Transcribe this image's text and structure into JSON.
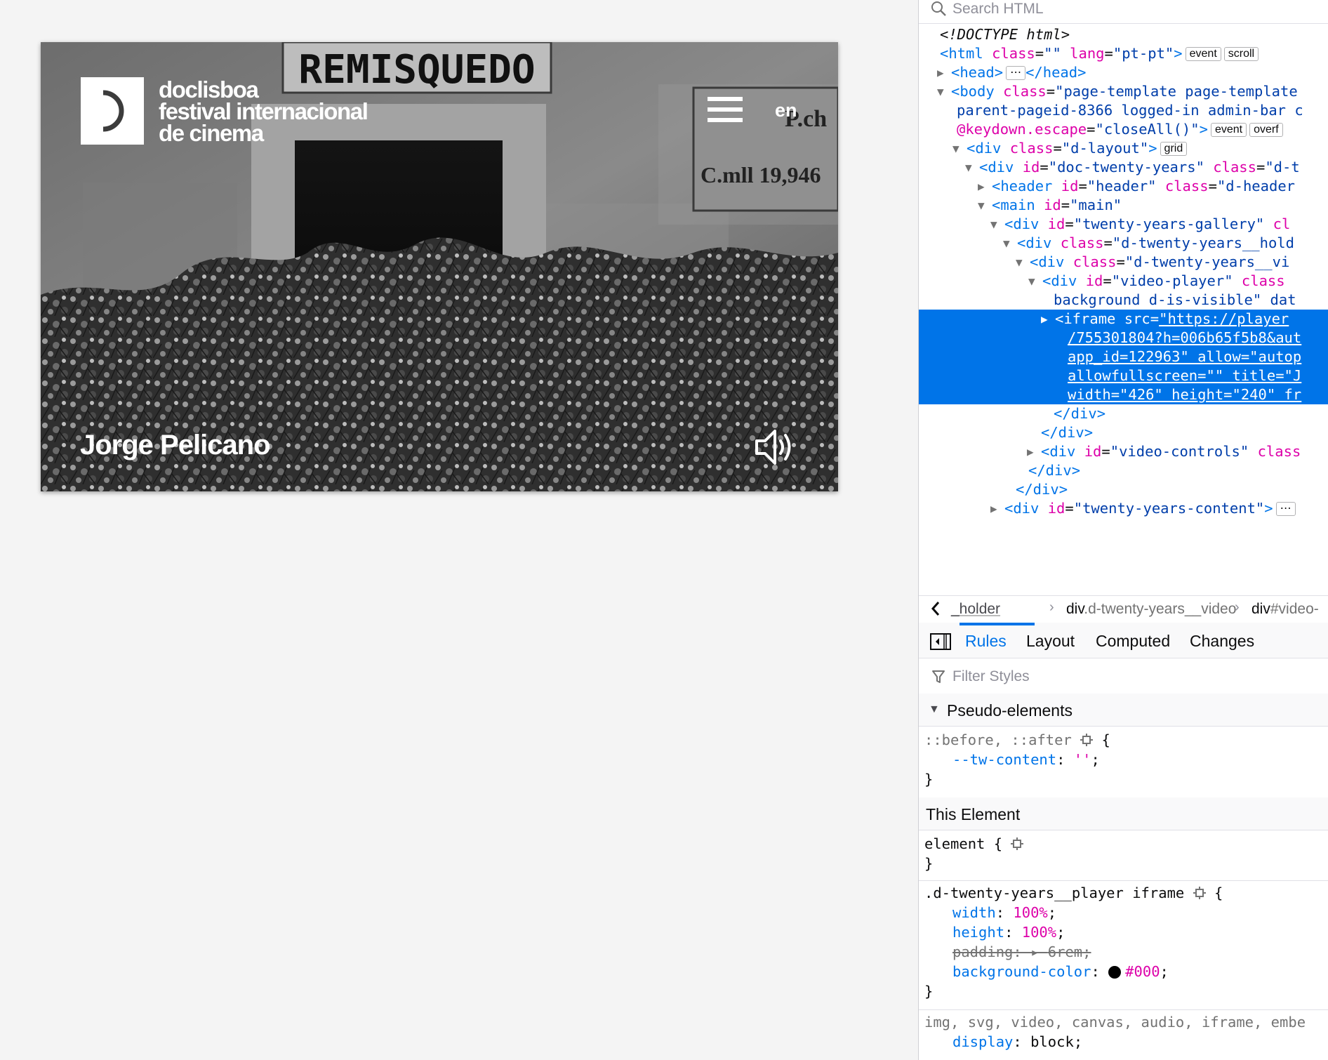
{
  "page": {
    "logo_lines": [
      "doclisboa",
      "festival internacional",
      "de cinema"
    ],
    "lang_link": "en",
    "director_name": "Jorge Pelicano",
    "sign_text": "REMISQUEDO",
    "plaque_text": "C.mll 19,946"
  },
  "devtools": {
    "search_placeholder": "Search HTML",
    "tree": [
      {
        "t": "<!DOCTYPE html>"
      },
      {
        "open": "<",
        "tag": "html",
        "attrs": [
          [
            "class",
            "\"\""
          ],
          [
            "lang",
            "\"pt-pt\""
          ]
        ],
        "close": ">",
        "badges": [
          "event",
          "scroll"
        ]
      },
      {
        "tag": "head",
        "collapsed": true,
        "ellipsis": "⋯",
        "endtag": "</head>"
      },
      {
        "tag": "body",
        "attrs": [
          [
            "class",
            "\"page-template page-template"
          ]
        ]
      },
      {
        "cont": "parent-pageid-8366 logged-in admin-bar c"
      },
      {
        "cont_attr": "@keydown.escape",
        "cont_val": "\"closeAll()\"",
        "badges": [
          "event",
          "overf"
        ]
      },
      {
        "tag": "div",
        "attrs": [
          [
            "class",
            "\"d-layout\""
          ]
        ],
        "badges": [
          "grid"
        ]
      },
      {
        "tag": "div",
        "attrs": [
          [
            "id",
            "\"doc-twenty-years\""
          ],
          [
            "class",
            "\"d-t"
          ]
        ]
      },
      {
        "tag": "header",
        "attrs": [
          [
            "id",
            "\"header\""
          ],
          [
            "class",
            "\"d-header"
          ]
        ]
      },
      {
        "tag": "main",
        "attrs": [
          [
            "id",
            "\"main\""
          ]
        ]
      },
      {
        "tag": "div",
        "attrs": [
          [
            "id",
            "\"twenty-years-gallery\""
          ],
          [
            "cl",
            ""
          ]
        ]
      },
      {
        "tag": "div",
        "attrs": [
          [
            "class",
            "\"d-twenty-years__hold"
          ]
        ]
      },
      {
        "tag": "div",
        "attrs": [
          [
            "class",
            "\"d-twenty-years__vi"
          ]
        ]
      },
      {
        "tag": "div",
        "attrs": [
          [
            "id",
            "\"video-player\""
          ],
          [
            "class",
            ""
          ]
        ]
      },
      {
        "cont": "background d-is-visible\" dat"
      },
      {
        "tag": "iframe",
        "attrs": [
          [
            "src",
            "\"https://player"
          ]
        ]
      },
      {
        "cont": "/755301804?h=006b65f5b8&aut"
      },
      {
        "cont": "app_id=122963\" allow=\"autop"
      },
      {
        "cont": "allowfullscreen=\"\" title=\"J"
      },
      {
        "cont": "width=\"426\" height=\"240\" fr"
      },
      {
        "endtag": "</div>"
      },
      {
        "endtag": "</div>"
      },
      {
        "tag": "div",
        "attrs": [
          [
            "id",
            "\"video-controls\""
          ],
          [
            "class",
            ""
          ]
        ]
      },
      {
        "endtag": "</div>"
      },
      {
        "endtag": "</div>"
      },
      {
        "tag": "div",
        "attrs": [
          [
            "id",
            "\"twenty-years-content\""
          ]
        ]
      }
    ],
    "breadcrumbs": [
      {
        "a": "_holder",
        "b": ""
      },
      {
        "a": "div",
        "b": ".d-twenty-years__video"
      },
      {
        "a": "div",
        "b": "#video-"
      }
    ],
    "tabs": [
      "Rules",
      "Layout",
      "Computed",
      "Changes"
    ],
    "filter_placeholder": "Filter Styles",
    "section_pseudo": "Pseudo-elements",
    "section_this": "This Element",
    "rules": {
      "pseudo_selector": "::before, ::after",
      "pseudo_prop": "--tw-content",
      "pseudo_val": "''",
      "element_selector": "element",
      "iframe_selector": ".d-twenty-years__player iframe",
      "iframe_props": [
        {
          "name": "width",
          "value": "100%"
        },
        {
          "name": "height",
          "value": "100%"
        },
        {
          "name": "padding",
          "value": "6rem",
          "struck": true
        },
        {
          "name": "background-color",
          "value": "#000"
        }
      ],
      "media_selector": "img, svg, video, canvas, audio, iframe, embe",
      "media_prop": "display",
      "media_val": "block"
    }
  }
}
